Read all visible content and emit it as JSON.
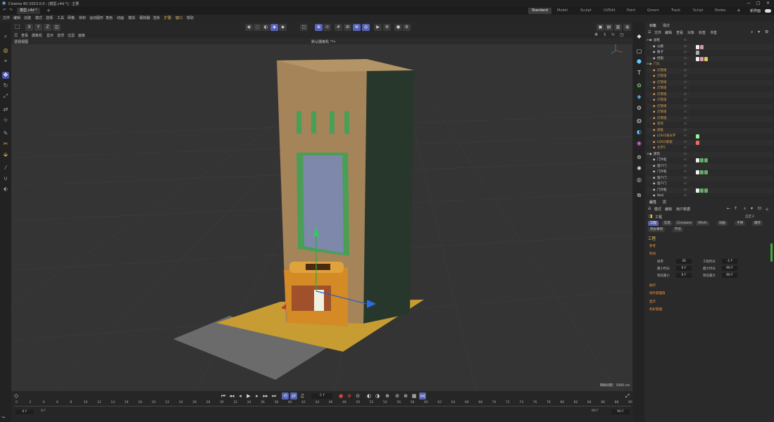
{
  "app": {
    "title": "Cinema 4D 2023.0.0 - [模型.c4d *] - 主要",
    "doc_tab": "模型.c4d *"
  },
  "layouts": [
    "Standard",
    "Model",
    "Sculpt",
    "UVEdit",
    "Paint",
    "Groom",
    "Track",
    "Script",
    "Nodes"
  ],
  "new_interface": "新界面",
  "menu": [
    "文件",
    "编辑",
    "创建",
    "模式",
    "选择",
    "工具",
    "网格",
    "体积",
    "运动图形",
    "角色",
    "动画",
    "模拟",
    "跟踪器",
    "渲染",
    "扩展",
    "窗口",
    "帮助"
  ],
  "view_menu": [
    "查看",
    "摄像机",
    "显示",
    "选项",
    "过滤",
    "面板"
  ],
  "viewport": {
    "label": "透视视图",
    "camera": "默认摄像机 °?•",
    "grid": "网格间距：1000 cm"
  },
  "axis_lock": [
    "X",
    "Y",
    "Z"
  ],
  "objects_panel": {
    "tabs": [
      "对象",
      "场次"
    ],
    "menu": [
      "文件",
      "编辑",
      "查看",
      "对象",
      "标签",
      "书签"
    ],
    "rows": [
      {
        "name": "画框",
        "color": "#c8c8c8",
        "indent": 0
      },
      {
        "name": "公路",
        "color": "#c8c8c8",
        "indent": 1
      },
      {
        "name": "路子",
        "color": "#c8c8c8",
        "indent": 1
      },
      {
        "name": "挡雨",
        "color": "#c8c8c8",
        "indent": 1
      },
      {
        "name": "门头",
        "color": "#e0a050",
        "indent": 0
      },
      {
        "name": "灯管组",
        "color": "#e0a050",
        "indent": 1
      },
      {
        "name": "灯管组",
        "color": "#e0a050",
        "indent": 1
      },
      {
        "name": "灯管组",
        "color": "#e0a050",
        "indent": 1
      },
      {
        "name": "灯管组",
        "color": "#e0a050",
        "indent": 1
      },
      {
        "name": "灯管组",
        "color": "#e0a050",
        "indent": 1
      },
      {
        "name": "灯管组",
        "color": "#e0a050",
        "indent": 1
      },
      {
        "name": "灯管组",
        "color": "#e0a050",
        "indent": 1
      },
      {
        "name": "灯管组",
        "color": "#e0a050",
        "indent": 1
      },
      {
        "name": "灯管组",
        "color": "#e0a050",
        "indent": 1
      },
      {
        "name": "装饰",
        "color": "#e0a050",
        "indent": 1
      },
      {
        "name": "底框",
        "color": "#e0a050",
        "indent": 1
      },
      {
        "name": "LOGO发光字",
        "color": "#e0a050",
        "indent": 1
      },
      {
        "name": "LOGO底板",
        "color": "#e0a050",
        "indent": 1
      },
      {
        "name": "文字5",
        "color": "#e0a050",
        "indent": 1
      },
      {
        "name": "建筑",
        "color": "#c8c8c8",
        "indent": 0
      },
      {
        "name": "门外框",
        "color": "#c8c8c8",
        "indent": 1
      },
      {
        "name": "窗户门",
        "color": "#c8c8c8",
        "indent": 1
      },
      {
        "name": "门外框",
        "color": "#c8c8c8",
        "indent": 1
      },
      {
        "name": "窗户门",
        "color": "#c8c8c8",
        "indent": 1
      },
      {
        "name": "窗户门",
        "color": "#c8c8c8",
        "indent": 1
      },
      {
        "name": "门外框",
        "color": "#c8c8c8",
        "indent": 1
      },
      {
        "name": "Wall",
        "color": "#c8c8c8",
        "indent": 1
      }
    ]
  },
  "attr_panel": {
    "tabs": [
      "属性",
      "层"
    ],
    "menu": [
      "模式",
      "编辑",
      "用户数据"
    ],
    "title": "工程",
    "preset": "自定义",
    "buttons": [
      "工程",
      "信息",
      "Cineware",
      "XRefs",
      "动画",
      "子弹",
      "缓存"
    ],
    "buttons2": [
      "待办事项",
      "节点"
    ],
    "section": "工程",
    "groups": [
      "参考",
      "时间",
      "执行",
      "场外部面值",
      "显示",
      "色彩管理"
    ],
    "fields": [
      {
        "label": "帧率",
        "value": "30",
        "label2": "工程时长",
        "value2": "-1 F"
      },
      {
        "label": "最小时长",
        "value": "0 F",
        "label2": "最大时长",
        "value2": "90 F"
      },
      {
        "label": "预览最小",
        "value": "0 F",
        "label2": "预览最大",
        "value2": "90 F"
      }
    ]
  },
  "timeline": {
    "ticks": [
      "0",
      "2",
      "4",
      "6",
      "8",
      "10",
      "12",
      "14",
      "16",
      "18",
      "20",
      "22",
      "24",
      "26",
      "28",
      "30",
      "32",
      "34",
      "36",
      "38",
      "40",
      "42",
      "44",
      "46",
      "48",
      "50",
      "52",
      "54",
      "56",
      "58",
      "60",
      "62",
      "64",
      "66",
      "68",
      "70",
      "72",
      "74",
      "76",
      "78",
      "80",
      "82",
      "84",
      "86",
      "88",
      "90"
    ],
    "current": "-1 F",
    "start": "0 F",
    "start2": "0 F",
    "end": "90 F",
    "end2": "90 F"
  },
  "colors": {
    "accent": "#5763b7",
    "orange": "#e0a050"
  }
}
